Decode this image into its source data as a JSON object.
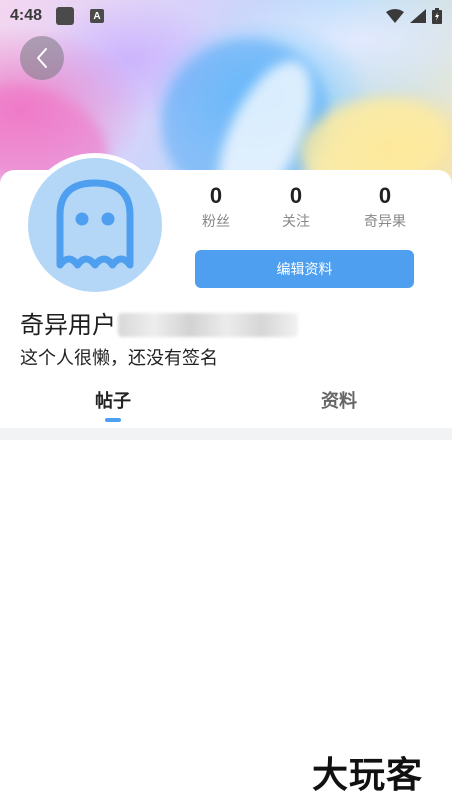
{
  "status_bar": {
    "time": "4:48",
    "app_icon": "square-app-icon",
    "keyboard_icon_letter": "A",
    "icons": [
      "wifi-icon",
      "signal-icon",
      "battery-charging-icon"
    ]
  },
  "header": {
    "back_icon": "chevron-left-icon"
  },
  "profile": {
    "avatar_icon": "ghost-icon",
    "avatar_color": "#b5d7f7",
    "avatar_glyph_color": "#4f9ff0",
    "stats": [
      {
        "value": "0",
        "label": "粉丝"
      },
      {
        "value": "0",
        "label": "关注"
      },
      {
        "value": "0",
        "label": "奇异果"
      }
    ],
    "edit_button_label": "编辑资料",
    "username": "奇异用户",
    "signature": "这个人很懒，还没有签名"
  },
  "tabs": [
    {
      "label": "帖子",
      "active": true
    },
    {
      "label": "资料",
      "active": false
    }
  ],
  "accent_color": "#4f9ff0",
  "watermark": "大玩客"
}
